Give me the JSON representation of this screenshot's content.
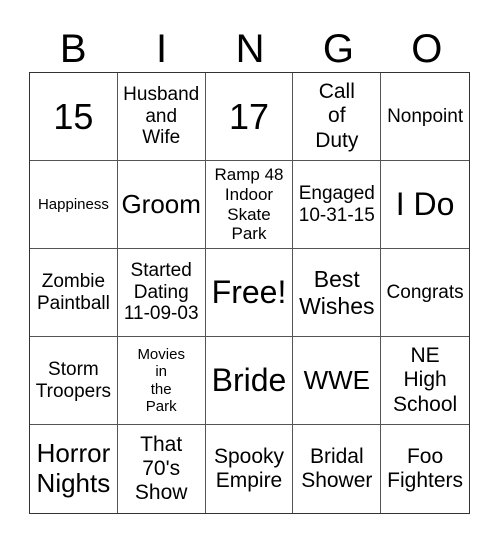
{
  "header": [
    "B",
    "I",
    "N",
    "G",
    "O"
  ],
  "cells": [
    "15",
    "Husband\nand\nWife",
    "17",
    "Call\nof\nDuty",
    "Nonpoint",
    "Happiness",
    "Groom",
    "Ramp 48\nIndoor\nSkate\nPark",
    "Engaged\n10-31-15",
    "I Do",
    "Zombie\nPaintball",
    "Started\nDating\n11-09-03",
    "Free!",
    "Best\nWishes",
    "Congrats",
    "Storm\nTroopers",
    "Movies\nin\nthe\nPark",
    "Bride",
    "WWE",
    "NE\nHigh\nSchool",
    "Horror\nNights",
    "That\n70's\nShow",
    "Spooky\nEmpire",
    "Bridal\nShower",
    "Foo\nFighters"
  ]
}
